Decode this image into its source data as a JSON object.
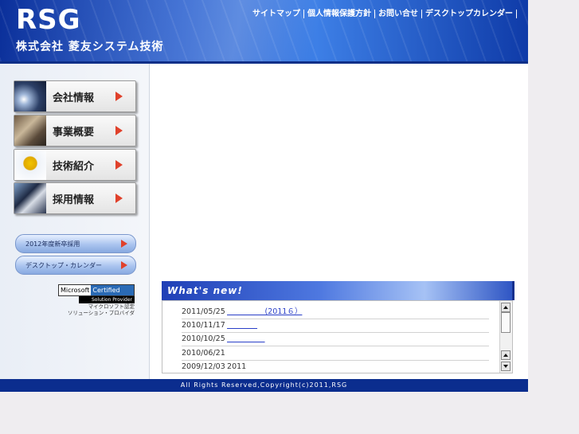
{
  "header": {
    "logo": "RSG",
    "company_name": "株式会社 菱友システム技術",
    "nav": [
      "サイトマップ",
      "個人情報保護方針",
      "お問い合せ",
      "デスクトップカレンダー"
    ]
  },
  "sidebar": {
    "menu": [
      {
        "label": "会社情報"
      },
      {
        "label": "事業概要"
      },
      {
        "label": "技術紹介"
      },
      {
        "label": "採用情報"
      }
    ],
    "banners": [
      "2012年度新卒採用",
      "デスクトップ・カレンダー"
    ],
    "microsoft": {
      "brand": "Microsoft",
      "certified": "Certified",
      "solution_provider": "Solution Provider",
      "sub1": "マイクロソフト認定",
      "sub2": "ソリューション・プロバイダ"
    }
  },
  "whats_new": {
    "title": "What's new!",
    "items": [
      {
        "date": "2011/05/25",
        "text": "　　　　　(2011６）"
      },
      {
        "date": "2010/11/17",
        "text": "　　　　"
      },
      {
        "date": "2010/10/25",
        "text": "　　　　　"
      },
      {
        "date": "2010/06/21",
        "text": ""
      },
      {
        "date": "2009/12/03",
        "text": "2011"
      }
    ]
  },
  "footer": {
    "copyright": "All Rights Reserved,Copyright(c)2011,RSG"
  },
  "colors": {
    "brand_blue": "#0b2d8e",
    "arrow_red": "#e0412b",
    "link": "#2a3fc8"
  }
}
